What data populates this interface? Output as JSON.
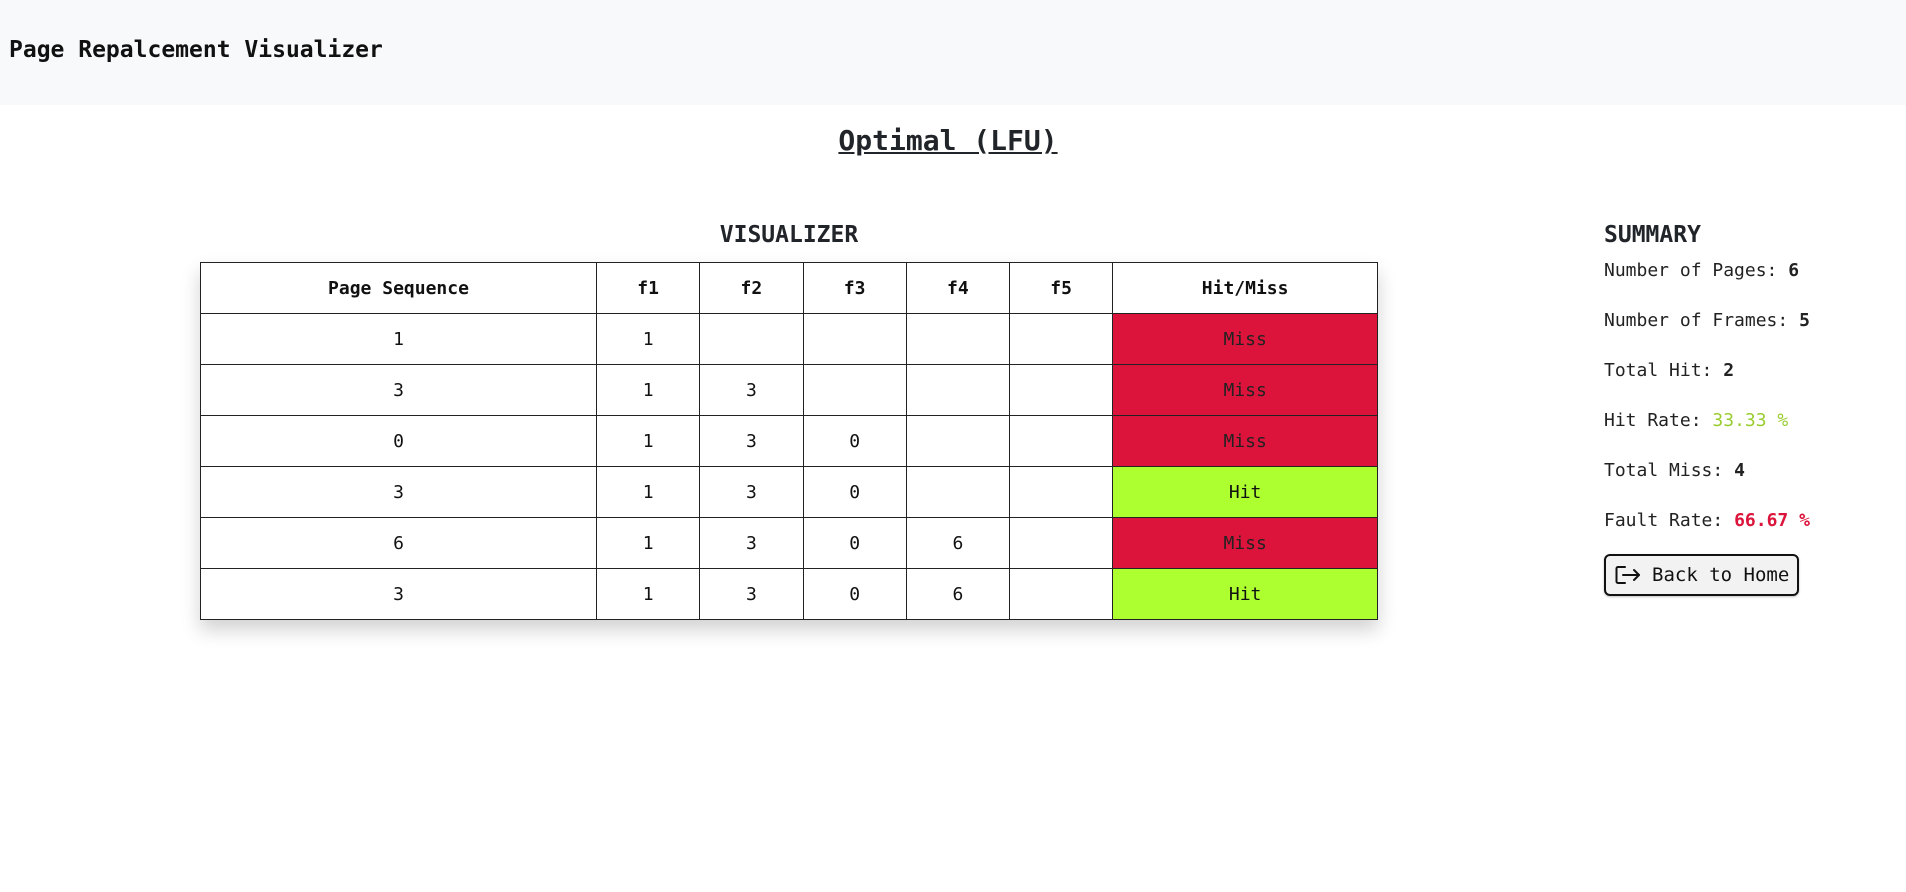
{
  "navbar": {
    "brand": "Page Repalcement Visualizer"
  },
  "algorithm_title": "Optimal (LFU)",
  "visualizer": {
    "heading": "VISUALIZER",
    "headers": [
      "Page Sequence",
      "f1",
      "f2",
      "f3",
      "f4",
      "f5",
      "Hit/Miss"
    ],
    "rows": [
      {
        "page": "1",
        "frames": [
          "1",
          "",
          "",
          "",
          ""
        ],
        "result": "Miss"
      },
      {
        "page": "3",
        "frames": [
          "1",
          "3",
          "",
          "",
          ""
        ],
        "result": "Miss"
      },
      {
        "page": "0",
        "frames": [
          "1",
          "3",
          "0",
          "",
          ""
        ],
        "result": "Miss"
      },
      {
        "page": "3",
        "frames": [
          "1",
          "3",
          "0",
          "",
          ""
        ],
        "result": "Hit"
      },
      {
        "page": "6",
        "frames": [
          "1",
          "3",
          "0",
          "6",
          ""
        ],
        "result": "Miss"
      },
      {
        "page": "3",
        "frames": [
          "1",
          "3",
          "0",
          "6",
          ""
        ],
        "result": "Hit"
      }
    ]
  },
  "summary": {
    "heading": "SUMMARY",
    "pages_label": "Number of Pages:",
    "pages_value": "6",
    "frames_label": "Number of Frames:",
    "frames_value": "5",
    "hit_label": "Total Hit:",
    "hit_value": "2",
    "hit_rate_label": "Hit Rate:",
    "hit_rate_value": "33.33 %",
    "miss_label": "Total Miss:",
    "miss_value": "4",
    "fault_rate_label": "Fault Rate:",
    "fault_rate_value": "66.67 %",
    "back_button": "Back to Home"
  },
  "colors": {
    "hit": "#adff2f",
    "miss": "#dc143c",
    "hit_rate_text": "#9acd32",
    "fault_rate_text": "#dc143c",
    "navbar_bg": "#f8f9fa"
  },
  "icons": {
    "back_button_icon": "box-arrow-right-icon"
  }
}
